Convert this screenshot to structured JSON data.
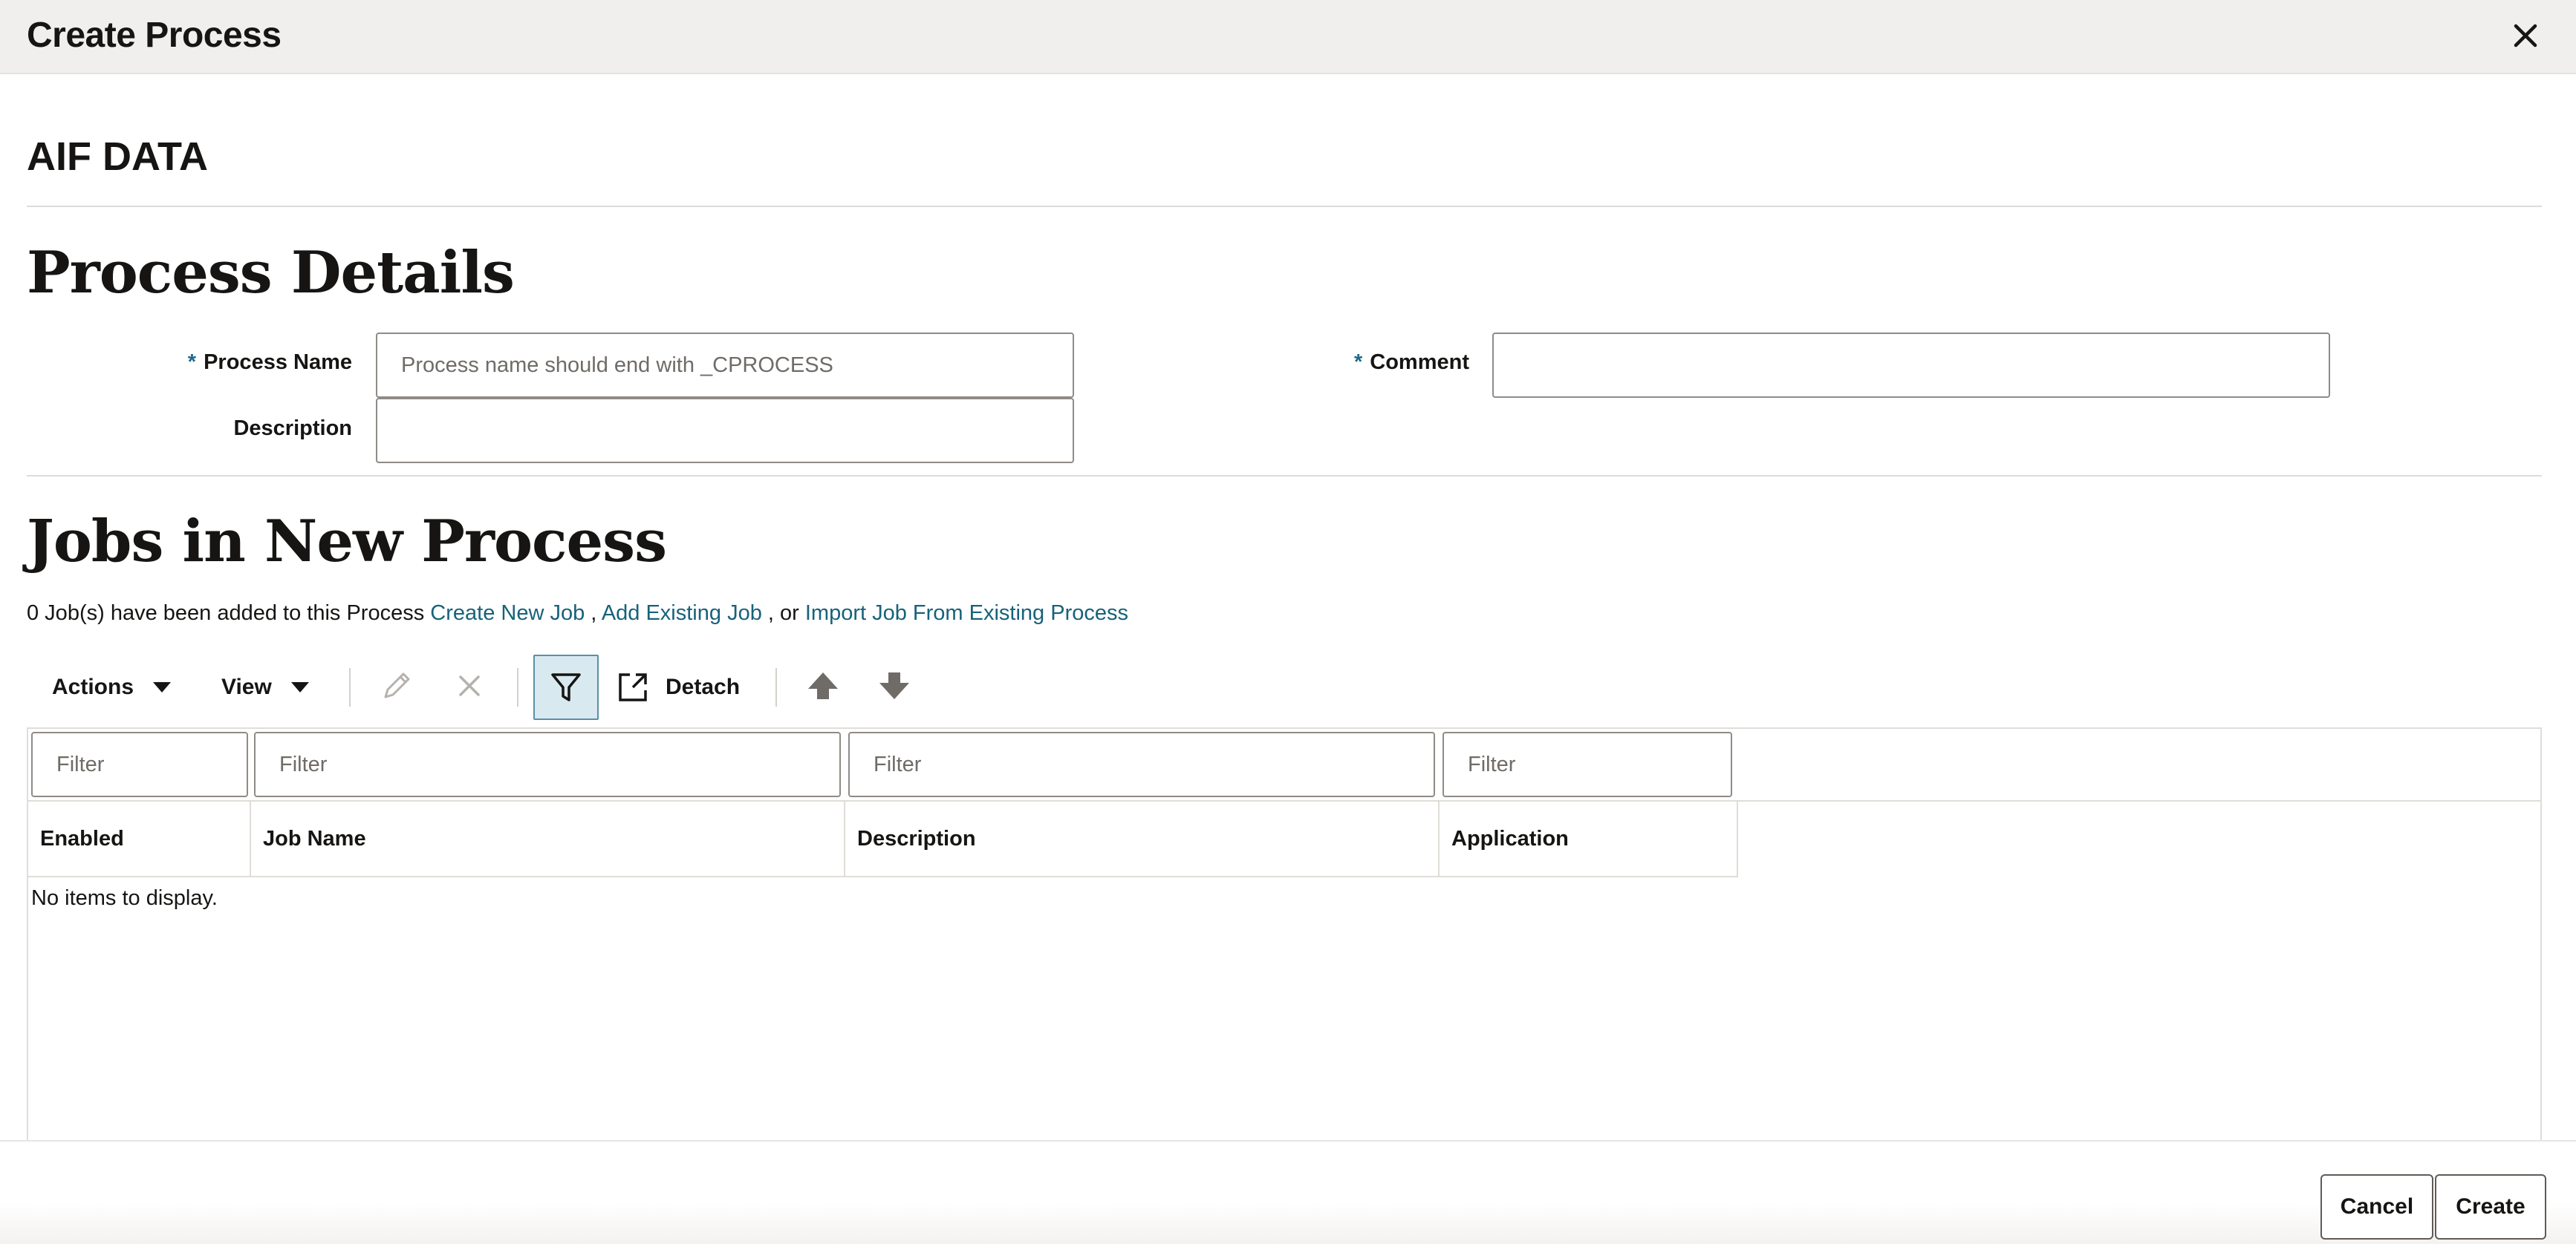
{
  "dialog": {
    "title": "Create Process",
    "close_icon": "close-icon"
  },
  "context": {
    "title": "AIF DATA"
  },
  "process_details": {
    "heading": "Process Details",
    "required_marker": "*",
    "process_name_label": "Process Name",
    "process_name_value": "",
    "process_name_placeholder": "Process name should end with _CPROCESS",
    "comment_label": "Comment",
    "comment_value": "",
    "description_label": "Description",
    "description_value": ""
  },
  "jobs": {
    "heading": "Jobs in New Process",
    "summary_text": "0 Job(s) have been added to this Process",
    "create_new_job_link": "Create New Job",
    "separator_comma": ",",
    "add_existing_job_link": "Add Existing Job",
    "separator_or": ", or",
    "import_job_link": "Import Job From Existing Process"
  },
  "toolbar": {
    "actions_label": "Actions",
    "view_label": "View",
    "detach_label": "Detach",
    "icons": [
      "edit-icon",
      "delete-icon",
      "filter-icon",
      "detach-icon",
      "move-up-icon",
      "move-down-icon"
    ]
  },
  "table": {
    "filter_placeholder": "Filter",
    "columns": [
      "Enabled",
      "Job Name",
      "Description",
      "Application"
    ],
    "empty_message": "No items to display."
  },
  "footer": {
    "cancel_label": "Cancel",
    "create_label": "Create"
  },
  "colors": {
    "link": "#17627a",
    "header_bg": "#f1efed",
    "filter_active_bg": "#d9e9f0"
  }
}
